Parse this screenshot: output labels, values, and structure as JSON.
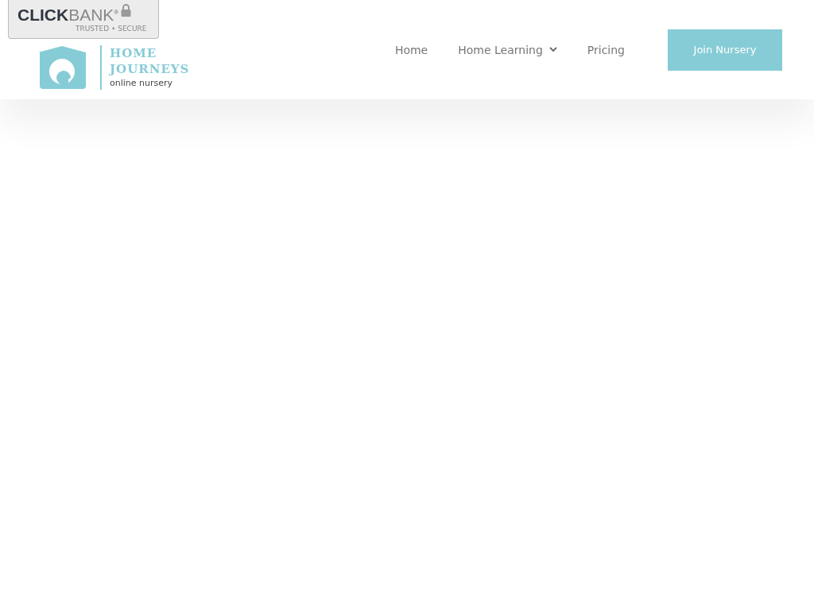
{
  "badge": {
    "brand_bold": "CLICK",
    "brand_light": "BANK",
    "registered": "®",
    "tagline": "TRUSTED • SECURE"
  },
  "logo": {
    "line_1": "HOME",
    "line_2": "JOURNEYS",
    "line_3": "online nursery"
  },
  "nav": [
    {
      "label": "Home",
      "has_dropdown": false
    },
    {
      "label": "Home Learning",
      "has_dropdown": true
    },
    {
      "label": "Pricing",
      "has_dropdown": false
    }
  ],
  "cta": {
    "label": "Join Nursery"
  }
}
